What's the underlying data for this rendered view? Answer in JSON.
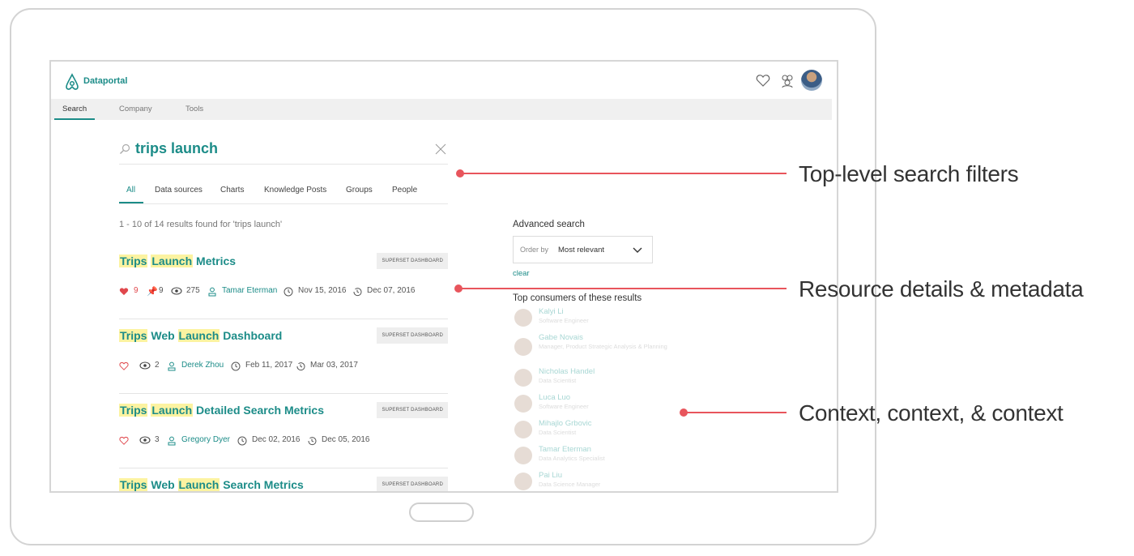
{
  "app": {
    "brand": "Dataportal"
  },
  "nav": {
    "items": [
      "Search",
      "Company",
      "Tools"
    ]
  },
  "search": {
    "query": "trips launch"
  },
  "tabs": [
    "All",
    "Data sources",
    "Charts",
    "Knowledge Posts",
    "Groups",
    "People"
  ],
  "results_summary": "1 - 10 of 14 results found for 'trips launch'",
  "results": [
    {
      "title_parts": [
        {
          "text": "Trips",
          "hl": true
        },
        {
          "text": " ",
          "hl": false
        },
        {
          "text": "Launch",
          "hl": true
        },
        {
          "text": " Metrics",
          "hl": false
        }
      ],
      "badge": "SUPERSET DASHBOARD",
      "likes": "9",
      "pins": "9",
      "views": "275",
      "owner": "Tamar Eterman",
      "created": "Nov 15, 2016",
      "updated": "Dec 07, 2016"
    },
    {
      "title_parts": [
        {
          "text": "Trips",
          "hl": true
        },
        {
          "text": " Web ",
          "hl": false
        },
        {
          "text": "Launch",
          "hl": true
        },
        {
          "text": " Dashboard",
          "hl": false
        }
      ],
      "badge": "SUPERSET DASHBOARD",
      "views": "2",
      "owner": "Derek Zhou",
      "created": "Feb 11, 2017",
      "updated": "Mar 03, 2017"
    },
    {
      "title_parts": [
        {
          "text": "Trips",
          "hl": true
        },
        {
          "text": " ",
          "hl": false
        },
        {
          "text": "Launch",
          "hl": true
        },
        {
          "text": " Detailed Search Metrics",
          "hl": false
        }
      ],
      "badge": "SUPERSET DASHBOARD",
      "views": "3",
      "owner": "Gregory Dyer",
      "created": "Dec 02, 2016",
      "updated": "Dec 05, 2016"
    },
    {
      "title_parts": [
        {
          "text": "Trips",
          "hl": true
        },
        {
          "text": " Web ",
          "hl": false
        },
        {
          "text": "Launch",
          "hl": true
        },
        {
          "text": " Search Metrics",
          "hl": false
        }
      ],
      "badge": "SUPERSET DASHBOARD"
    }
  ],
  "advanced": {
    "title": "Advanced search",
    "order_label": "Order by",
    "order_value": "Most relevant",
    "clear": "clear"
  },
  "consumers": {
    "title": "Top consumers of these results",
    "people": [
      {
        "name": "Kalyi Li",
        "role": "Software Engineer"
      },
      {
        "name": "Gabe Novais",
        "role": "Manager, Product Strategic Analysis & Planning"
      },
      {
        "name": "Nicholas Handel",
        "role": "Data Scientist"
      },
      {
        "name": "Luca Luo",
        "role": "Software Engineer"
      },
      {
        "name": "Mihajlo Grbovic",
        "role": "Data Scientist"
      },
      {
        "name": "Tamar Eterman",
        "role": "Data Analytics Specialist"
      },
      {
        "name": "Pai Liu",
        "role": "Data Science Manager"
      }
    ]
  },
  "annotations": {
    "filters": "Top-level search filters",
    "details": "Resource details & metadata",
    "context": "Context, context, & context"
  },
  "colors": {
    "accent": "#1c8c88",
    "highlight": "#fcf3a1",
    "annotation": "#e8555c",
    "heart": "#e0474c"
  }
}
